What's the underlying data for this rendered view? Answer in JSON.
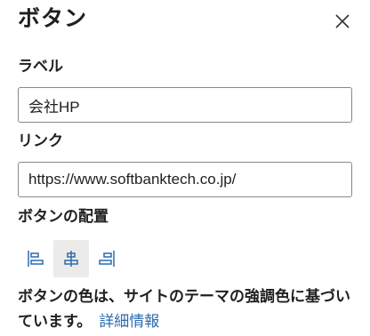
{
  "panel": {
    "title": "ボタン",
    "close_icon": "close-icon"
  },
  "label_field": {
    "label": "ラベル",
    "value": "会社HP"
  },
  "link_field": {
    "label": "リンク",
    "value": "https://www.softbanktech.co.jp/"
  },
  "placement": {
    "label": "ボタンの配置",
    "options": [
      {
        "icon": "align-left-icon",
        "selected": false
      },
      {
        "icon": "align-center-icon",
        "selected": true
      },
      {
        "icon": "align-right-icon",
        "selected": false
      }
    ]
  },
  "note": {
    "text": "ボタンの色は、サイトのテーマの強調色に基づいています。",
    "link": "詳細情報"
  },
  "colors": {
    "accent": "#2b6cb0",
    "selected_bg": "#edebe9",
    "border": "#8a8886"
  }
}
